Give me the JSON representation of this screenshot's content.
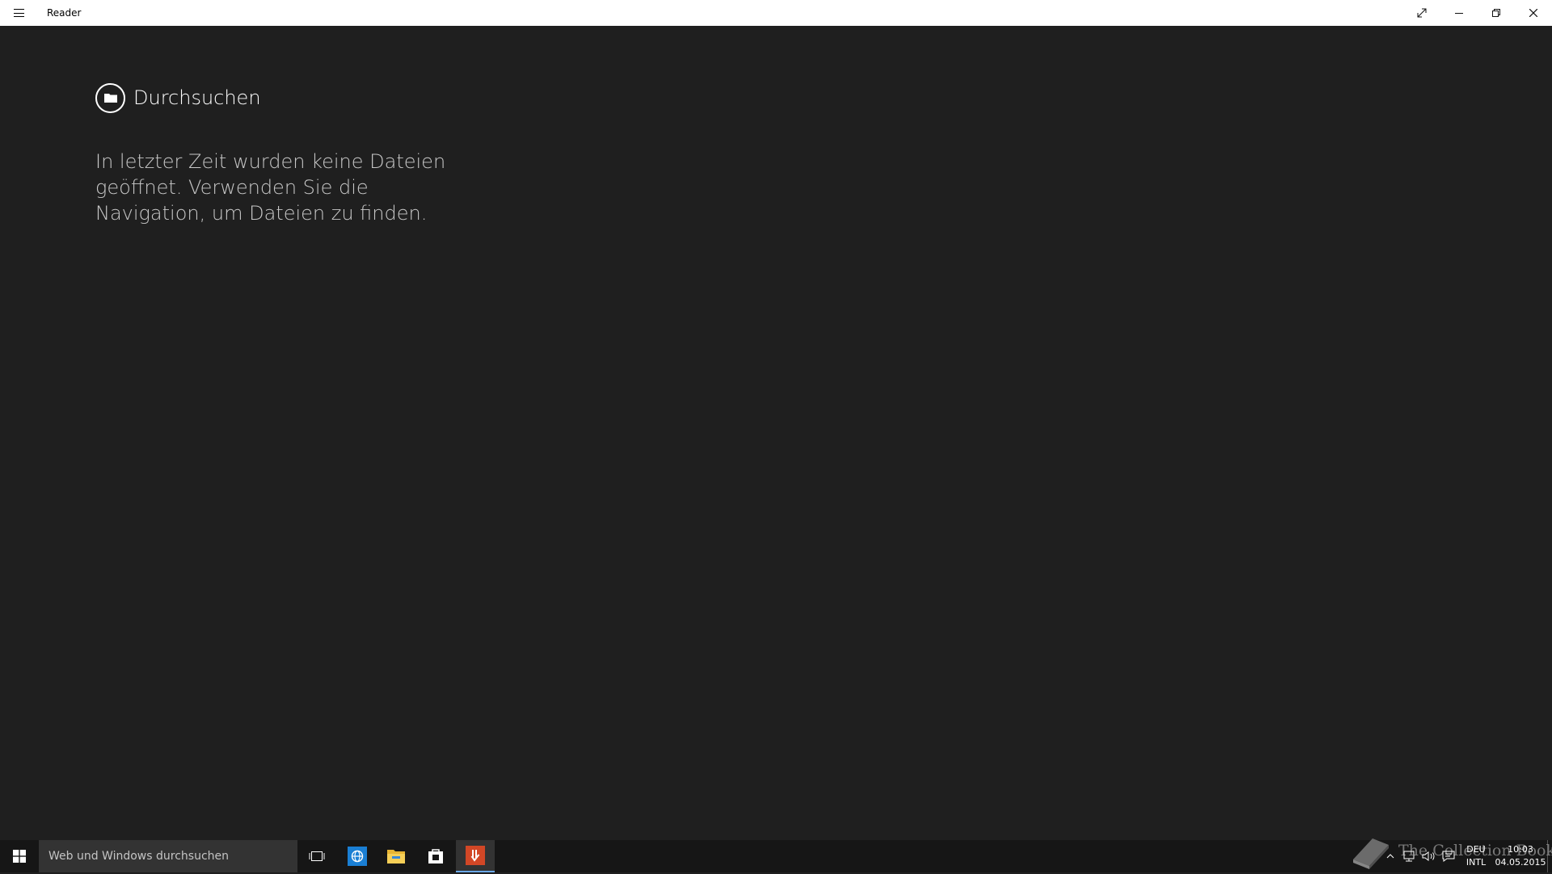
{
  "window": {
    "title": "Reader"
  },
  "content": {
    "browse_label": "Durchsuchen",
    "empty_message": "In letzter Zeit wurden keine Dateien geöffnet. Verwenden Sie die Navigation, um Dateien zu finden."
  },
  "taskbar": {
    "search_placeholder": "Web und Windows durchsuchen",
    "pinned": [
      "task-view",
      "internet-explorer",
      "file-explorer",
      "store",
      "reader"
    ],
    "active": "reader"
  },
  "tray": {
    "language_line1": "DEU",
    "language_line2": "INTL",
    "time": "10:03",
    "date": "04.05.2015"
  },
  "watermark": {
    "text": "The Collection Book"
  },
  "colors": {
    "background": "#1f1f1f",
    "titlebar": "#ffffff",
    "taskbar": "#161616",
    "reader_accent": "#d24726",
    "active_underline": "#6aa8e8"
  }
}
